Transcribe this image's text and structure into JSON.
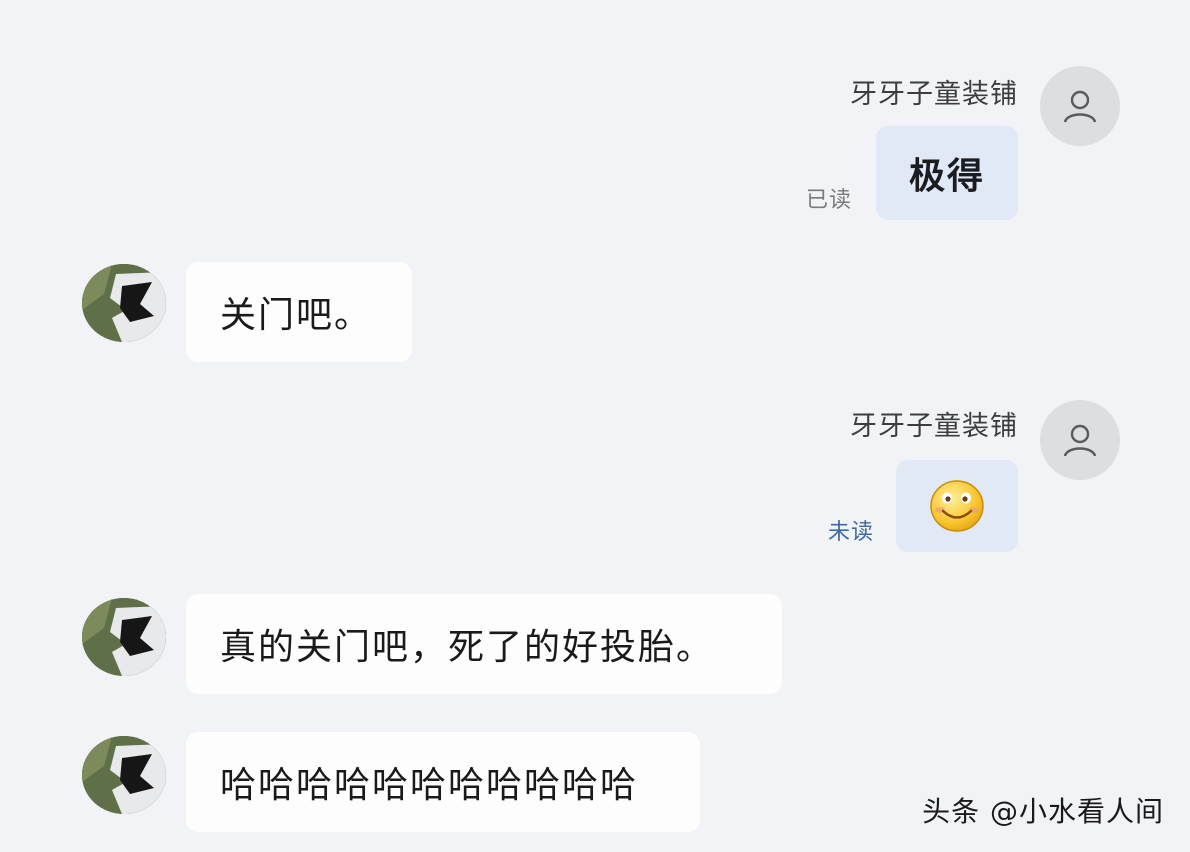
{
  "messages": [
    {
      "side": "right",
      "sender": "牙牙子童装铺",
      "text": "极得",
      "status": "已读"
    },
    {
      "side": "left",
      "text": "关门吧。"
    },
    {
      "side": "right",
      "sender": "牙牙子童装铺",
      "emoji": "smiley-emoji",
      "status": "未读"
    },
    {
      "side": "left",
      "text": "真的关门吧，死了的好投胎。"
    },
    {
      "side": "left",
      "text": "哈哈哈哈哈哈哈哈哈哈哈"
    }
  ],
  "watermark": "头条 @小水看人间",
  "colors": {
    "background": "#f1f3f6",
    "bubble_self": "#e1e9f6",
    "bubble_other": "#fdfdfe",
    "status_read": "#7a7a7a",
    "status_unread": "#3f6aa3"
  }
}
